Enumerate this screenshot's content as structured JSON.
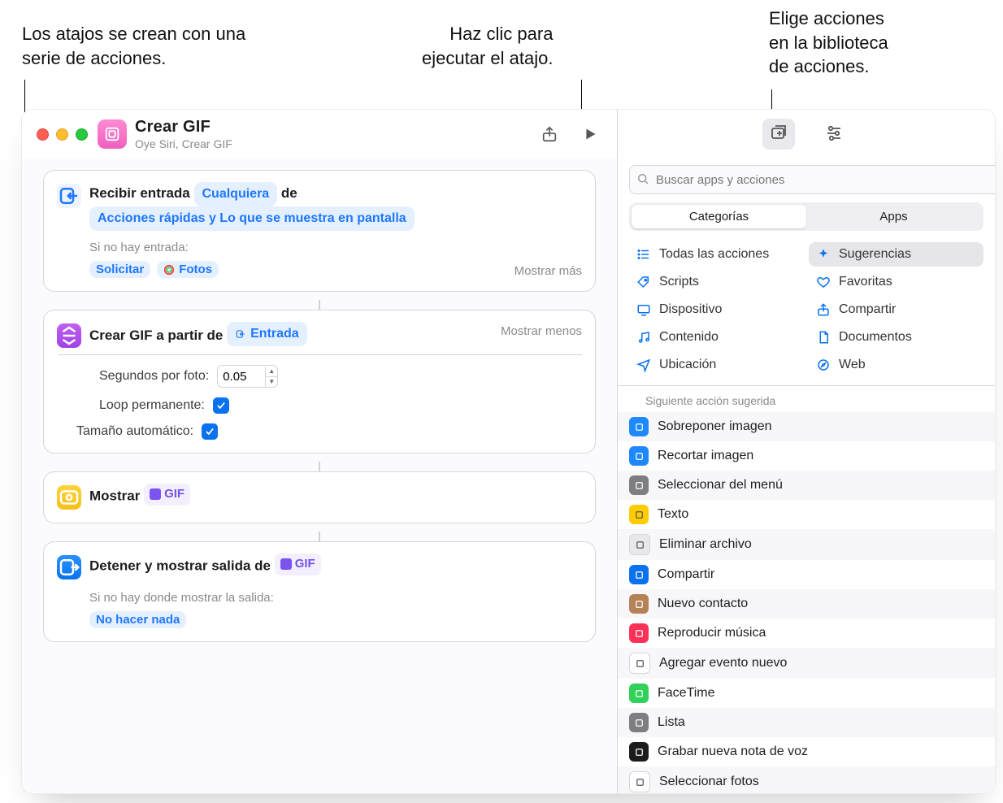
{
  "callouts": {
    "createdWith": "Los atajos se crean con una\nserie de acciones.",
    "clickRun": "Haz clic para\nejecutar el atajo.",
    "chooseActions": "Elige acciones\nen la biblioteca\nde acciones."
  },
  "titlebar": {
    "title": "Crear GIF",
    "subtitle": "Oye Siri, Crear GIF"
  },
  "actions": {
    "receive": {
      "lead": "Recibir entrada",
      "anyToken": "Cualquiera",
      "of": "de",
      "fromToken": "Acciones rápidas y Lo que se muestra en pantalla",
      "noInputLabel": "Si no hay entrada:",
      "askToken": "Solicitar",
      "photosToken": "Fotos",
      "more": "Mostrar más"
    },
    "makeGif": {
      "lead": "Crear GIF a partir de",
      "inputToken": "Entrada",
      "less": "Mostrar menos",
      "secondsLabel": "Segundos por foto:",
      "secondsValue": "0.05",
      "loopLabel": "Loop permanente:",
      "autoLabel": "Tamaño automático:"
    },
    "show": {
      "lead": "Mostrar",
      "gifToken": "GIF"
    },
    "stop": {
      "lead": "Detener y mostrar salida de",
      "gifToken": "GIF",
      "noOutputLabel": "Si no hay donde mostrar la salida:",
      "doNothingToken": "No hacer nada"
    }
  },
  "sidebar": {
    "searchPlaceholder": "Buscar apps y acciones",
    "segCategories": "Categorías",
    "segApps": "Apps",
    "cats": {
      "all": "Todas las acciones",
      "suggestions": "Sugerencias",
      "scripts": "Scripts",
      "favorites": "Favoritas",
      "device": "Dispositivo",
      "share": "Compartir",
      "content": "Contenido",
      "documents": "Documentos",
      "location": "Ubicación",
      "web": "Web"
    },
    "hint": "Siguiente acción sugerida",
    "rows": [
      {
        "label": "Sobreponer imagen",
        "bg": "#1e88ff"
      },
      {
        "label": "Recortar imagen",
        "bg": "#1e88ff"
      },
      {
        "label": "Seleccionar del menú",
        "bg": "#7d7d82"
      },
      {
        "label": "Texto",
        "bg": "#ffcc00"
      },
      {
        "label": "Eliminar archivo",
        "bg": "#e8e8ec"
      },
      {
        "label": "Compartir",
        "bg": "#0a72ef"
      },
      {
        "label": "Nuevo contacto",
        "bg": "#b58257"
      },
      {
        "label": "Reproducir música",
        "bg": "#fc3158"
      },
      {
        "label": "Agregar evento nuevo",
        "bg": "#ffffff"
      },
      {
        "label": "FaceTime",
        "bg": "#30d158"
      },
      {
        "label": "Lista",
        "bg": "#7d7d82"
      },
      {
        "label": "Grabar nueva nota de voz",
        "bg": "#1c1c1e"
      },
      {
        "label": "Seleccionar fotos",
        "bg": "#ffffff"
      }
    ]
  }
}
